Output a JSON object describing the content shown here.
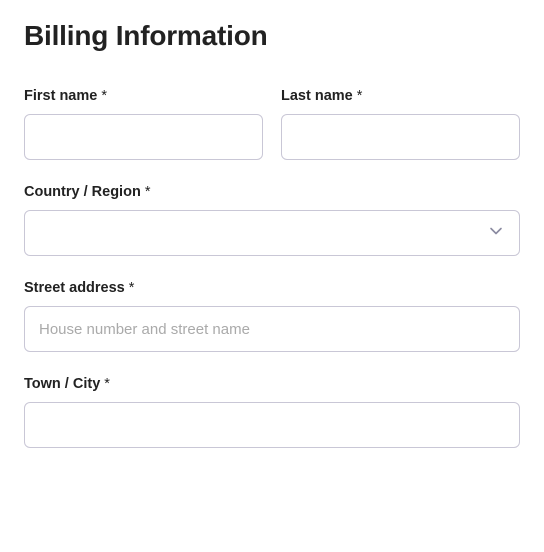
{
  "heading": "Billing Information",
  "required_mark": "*",
  "fields": {
    "first_name": {
      "label": "First name",
      "value": "",
      "placeholder": ""
    },
    "last_name": {
      "label": "Last name",
      "value": "",
      "placeholder": ""
    },
    "country": {
      "label": "Country / Region",
      "value": ""
    },
    "street": {
      "label": "Street address",
      "value": "",
      "placeholder": "House number and street name"
    },
    "city": {
      "label": "Town / City",
      "value": "",
      "placeholder": ""
    }
  }
}
